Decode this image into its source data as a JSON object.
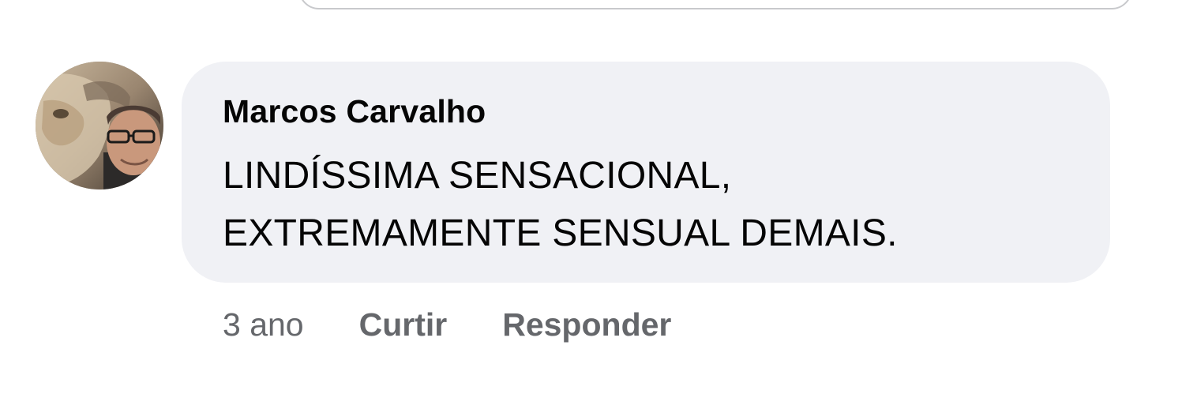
{
  "comment": {
    "author": "Marcos Carvalho",
    "text_lines": [
      "LINDÍSSIMA SENSACIONAL,",
      "EXTREMAMENTE SENSUAL DEMAIS."
    ]
  },
  "actions": {
    "time": "3 ano",
    "like_label": "Curtir",
    "reply_label": "Responder"
  },
  "colors": {
    "bubble": "#f0f1f5",
    "text": "#050505",
    "secondary": "#65676b"
  }
}
